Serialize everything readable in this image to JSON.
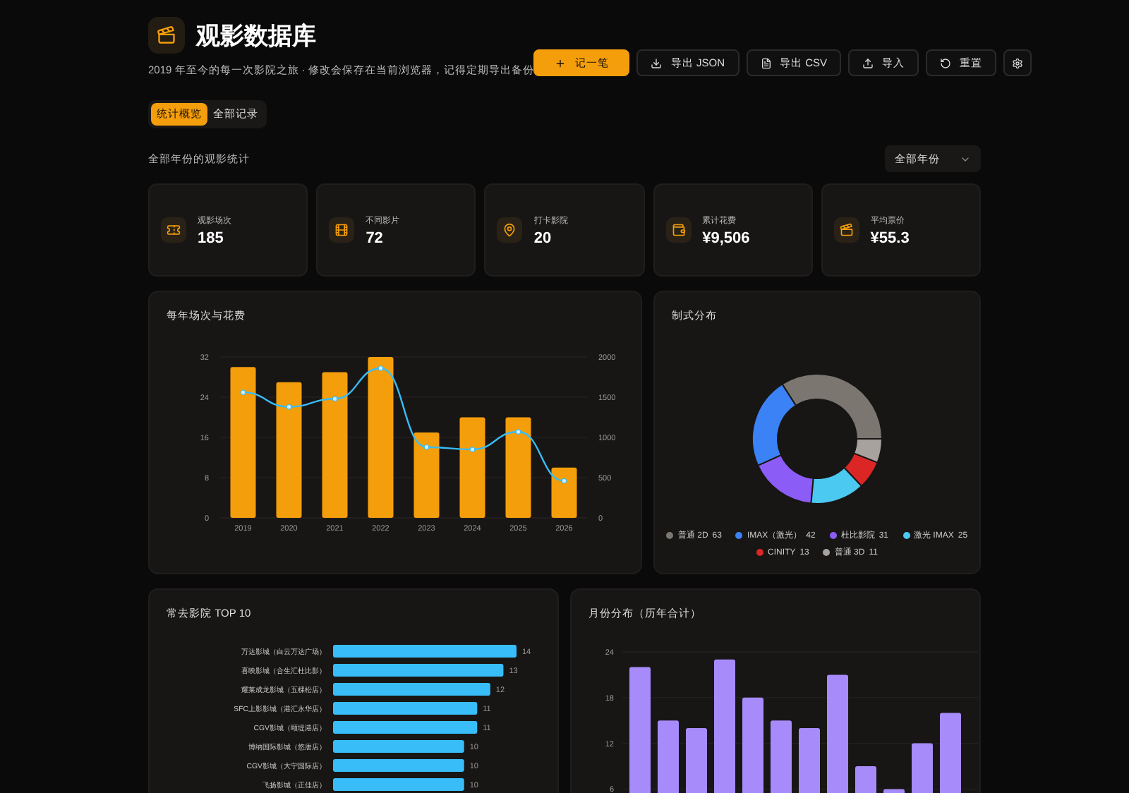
{
  "header": {
    "title": "观影数据库",
    "subtitle": "2019 年至今的每一次影院之旅 · 修改会保存在当前浏览器，记得定期导出备份"
  },
  "buttons": [
    {
      "kind": "primary",
      "label": "记一笔"
    },
    {
      "kind": "secondary",
      "label": "导出 JSON"
    },
    {
      "kind": "secondary",
      "label": "导出 CSV"
    },
    {
      "kind": "secondary",
      "label": "导入"
    },
    {
      "kind": "secondary",
      "label": "重置"
    },
    {
      "kind": "icon"
    }
  ],
  "tabs": [
    {
      "label": "统计概览",
      "selected": true
    },
    {
      "label": "全部记录",
      "selected": false
    }
  ],
  "section": {
    "label": "全部年份的观影统计",
    "year_select": {
      "value": "全部年份"
    }
  },
  "stats": [
    {
      "label": "观影场次",
      "value": "185"
    },
    {
      "label": "不同影片",
      "value": "72"
    },
    {
      "label": "打卡影院",
      "value": "20"
    },
    {
      "label": "累计花费",
      "value": "¥9,506"
    },
    {
      "label": "平均票价",
      "value": "¥55.3"
    }
  ],
  "yearly": {
    "title": "每年场次与花费",
    "chart_data": {
      "type": "bar",
      "categories": [
        "2019",
        "2020",
        "2021",
        "2022",
        "2023",
        "2024",
        "2025",
        "2026"
      ],
      "grid": true,
      "series": [
        {
          "type": "bar",
          "color": "#f59e0b",
          "values": [
            30,
            27,
            29,
            32,
            17,
            20,
            20,
            10
          ]
        },
        {
          "type": "line",
          "axis": "y2",
          "marker": "o",
          "color": "#38bdf8",
          "values": [
            1560,
            1380,
            1480,
            1860,
            880,
            850,
            1070,
            460
          ]
        }
      ],
      "ylim": [
        0,
        32
      ],
      "yticks": [
        0,
        8,
        16,
        24,
        32
      ],
      "y2lim": [
        0,
        2000
      ],
      "y2ticks": [
        0,
        500,
        1000,
        1500,
        2000
      ]
    }
  },
  "formats": {
    "title": "制式分布",
    "chart_data": {
      "type": "donut",
      "categories": [
        "普通 2D",
        "IMAX（激光）",
        "杜比影院",
        "激光 IMAX",
        "CINITY",
        "普通 3D"
      ],
      "values": [
        63,
        42,
        31,
        25,
        13,
        11
      ],
      "value_labels": [
        "63",
        "42",
        "31",
        "25",
        "13",
        "11"
      ],
      "legend": "bottom",
      "colors": [
        "#7c7670",
        "#3b82f6",
        "#8b5cf6",
        "#4cc9f0",
        "#dc2626",
        "#a8a29e"
      ]
    }
  },
  "cinemas": {
    "title": "常去影院 TOP 10",
    "chart_data": {
      "type": "bar",
      "orientation": "horizontal",
      "data_labels": true,
      "categories": [
        "万达影城（白云万达广场）",
        "喜映影城（合生汇杜比影）",
        "耀莱成龙影城（五棵松店）",
        "SFC上影影城（港汇永华店）",
        "CGV影城（颐堤港店）",
        "博纳国际影城（悠唐店）",
        "CGV影城（大宁国际店）",
        "飞扬影城（正佳店）"
      ],
      "series": [
        {
          "color": "#38bdf8",
          "values": [
            14,
            13,
            12,
            11,
            11,
            10,
            10,
            10
          ]
        }
      ]
    }
  },
  "months": {
    "title": "月份分布（历年合计）",
    "chart_data": {
      "type": "bar",
      "series": [
        {
          "color": "#a78bfa",
          "values": [
            22,
            15,
            14,
            23,
            18,
            15,
            14,
            21,
            9,
            6,
            12,
            16
          ]
        }
      ],
      "grid": true,
      "ylim": [
        0,
        24
      ],
      "yticks": [
        6,
        12,
        18,
        24
      ]
    }
  }
}
